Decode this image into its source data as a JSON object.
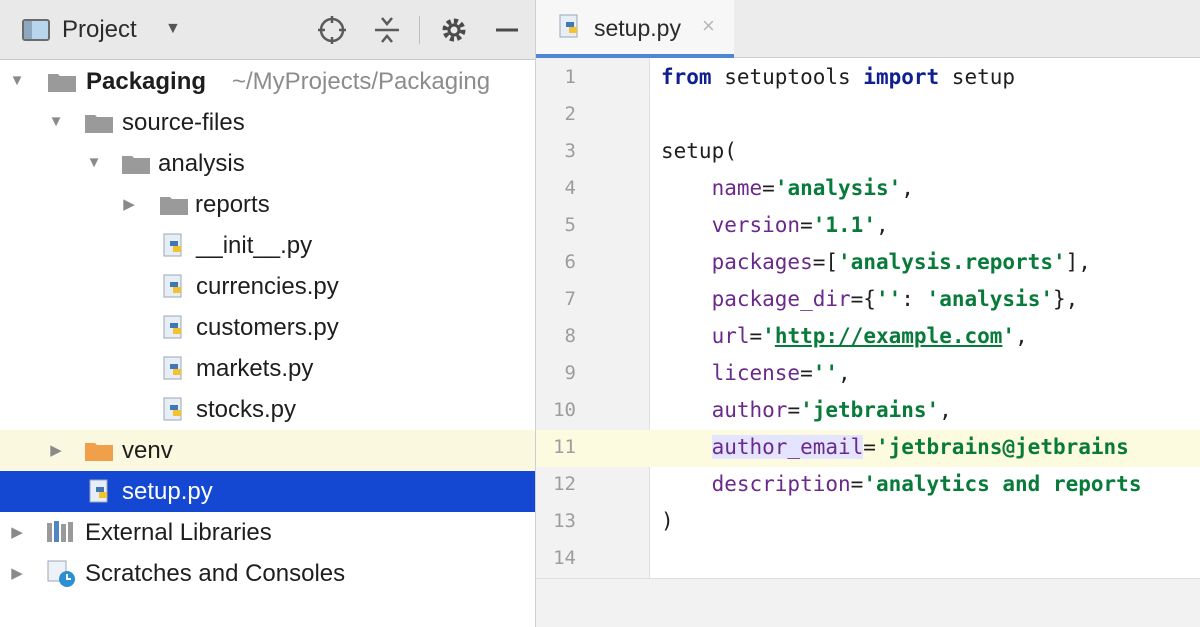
{
  "project_panel": {
    "title": "Project",
    "header_icons": [
      "crosshair-icon",
      "collapse-all-icon",
      "gear-icon",
      "minimize-icon"
    ],
    "tree": [
      {
        "label": "Packaging",
        "path": "~/MyProjects/Packaging",
        "type": "folder",
        "expanded": true
      },
      {
        "label": "source-files",
        "type": "folder",
        "expanded": true
      },
      {
        "label": "analysis",
        "type": "folder",
        "expanded": true
      },
      {
        "label": "reports",
        "type": "folder",
        "expanded": false
      },
      {
        "label": "__init__.py",
        "type": "python-file"
      },
      {
        "label": "currencies.py",
        "type": "python-file"
      },
      {
        "label": "customers.py",
        "type": "python-file"
      },
      {
        "label": "markets.py",
        "type": "python-file"
      },
      {
        "label": "stocks.py",
        "type": "python-file"
      },
      {
        "label": "venv",
        "type": "folder",
        "expanded": false
      },
      {
        "label": "setup.py",
        "type": "python-file",
        "selected": true
      },
      {
        "label": "External Libraries",
        "type": "library",
        "expanded": false
      },
      {
        "label": "Scratches and Consoles",
        "type": "scratches",
        "expanded": false
      }
    ]
  },
  "editor": {
    "tab": {
      "label": "setup.py",
      "close": "×"
    },
    "current_line": 11,
    "lines": [
      {
        "n": "1",
        "tokens": [
          [
            "kw",
            "from"
          ],
          [
            "",
            " setuptools "
          ],
          [
            "kw",
            "import"
          ],
          [
            "",
            " setup"
          ]
        ]
      },
      {
        "n": "2",
        "tokens": []
      },
      {
        "n": "3",
        "tokens": [
          [
            "",
            "setup("
          ]
        ]
      },
      {
        "n": "4",
        "tokens": [
          [
            "",
            "    "
          ],
          [
            "kwarg",
            "name"
          ],
          [
            "",
            "="
          ],
          [
            "str",
            "'analysis'"
          ],
          [
            "",
            ","
          ]
        ]
      },
      {
        "n": "5",
        "tokens": [
          [
            "",
            "    "
          ],
          [
            "kwarg",
            "version"
          ],
          [
            "",
            "="
          ],
          [
            "str",
            "'1.1'"
          ],
          [
            "",
            ","
          ]
        ]
      },
      {
        "n": "6",
        "tokens": [
          [
            "",
            "    "
          ],
          [
            "kwarg",
            "packages"
          ],
          [
            "",
            "=["
          ],
          [
            "str",
            "'analysis.reports'"
          ],
          [
            "",
            "],"
          ]
        ]
      },
      {
        "n": "7",
        "tokens": [
          [
            "",
            "    "
          ],
          [
            "kwarg",
            "package_dir"
          ],
          [
            "",
            "={"
          ],
          [
            "str",
            "''"
          ],
          [
            "",
            ": "
          ],
          [
            "str",
            "'analysis'"
          ],
          [
            "",
            "},"
          ]
        ]
      },
      {
        "n": "8",
        "tokens": [
          [
            "",
            "    "
          ],
          [
            "kwarg",
            "url"
          ],
          [
            "",
            "="
          ],
          [
            "str",
            "'"
          ],
          [
            "link",
            "http://example.com"
          ],
          [
            "str",
            "'"
          ],
          [
            "",
            ","
          ]
        ]
      },
      {
        "n": "9",
        "tokens": [
          [
            "",
            "    "
          ],
          [
            "kwarg",
            "license"
          ],
          [
            "",
            "="
          ],
          [
            "str",
            "''"
          ],
          [
            "",
            ","
          ]
        ]
      },
      {
        "n": "10",
        "tokens": [
          [
            "",
            "    "
          ],
          [
            "kwarg",
            "author"
          ],
          [
            "",
            "="
          ],
          [
            "str",
            "'jetbrains'"
          ],
          [
            "",
            ","
          ]
        ]
      },
      {
        "n": "11",
        "tokens": [
          [
            "",
            "    "
          ],
          [
            "kwarg hl-arg",
            "author_email"
          ],
          [
            "",
            "="
          ],
          [
            "str",
            "'jetbrains@jetbrains"
          ]
        ]
      },
      {
        "n": "12",
        "tokens": [
          [
            "",
            "    "
          ],
          [
            "kwarg",
            "description"
          ],
          [
            "",
            "="
          ],
          [
            "str",
            "'analytics and reports"
          ]
        ]
      },
      {
        "n": "13",
        "tokens": [
          [
            "",
            ")"
          ]
        ]
      },
      {
        "n": "14",
        "tokens": []
      }
    ]
  },
  "colors": {
    "selection": "#1447d2",
    "current_line": "#fcfadf",
    "keyword": "#0f1f8f",
    "string": "#087a3a",
    "kwarg": "#6a2a8c",
    "folder_gray": "#9a9a9a",
    "folder_orange": "#f0a04b"
  }
}
